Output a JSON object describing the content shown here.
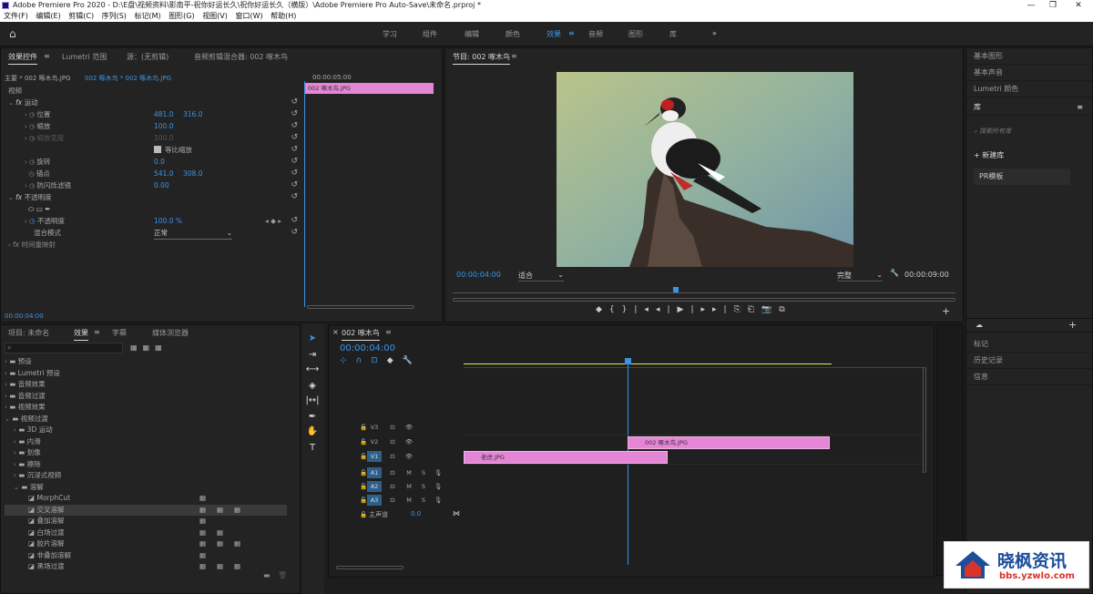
{
  "window": {
    "title": "Adobe Premiere Pro 2020 - D:\\E盘\\视频资料\\影南平-祝你好运长久\\祝你好运长久（横版）\\Adobe Premiere Pro Auto-Save\\未命名.prproj *",
    "min": "—",
    "max": "❐",
    "close": "✕"
  },
  "menu": [
    "文件(F)",
    "编辑(E)",
    "剪辑(C)",
    "序列(S)",
    "标记(M)",
    "图形(G)",
    "视图(V)",
    "窗口(W)",
    "帮助(H)"
  ],
  "workspaces": [
    "学习",
    "组件",
    "编辑",
    "颜色",
    "效果",
    "音频",
    "图形",
    "库"
  ],
  "workspace_more": "»",
  "effect_controls": {
    "tabs": [
      "效果控件",
      "Lumetri 范围",
      "源：(无剪辑)",
      "音频剪辑混合器: 002 啄木鸟"
    ],
    "master": "主要 * 002 啄木鸟.JPG",
    "clip": "002 啄木鸟 * 002 啄木鸟.JPG",
    "time_top": "00:00:05:00",
    "clip_label": "002 啄木鸟.JPG",
    "video": "视频",
    "motion": "运动",
    "position": "位置",
    "pos_x": "481.0",
    "pos_y": "316.0",
    "scale": "缩放",
    "scale_v": "100.0",
    "scale_w": "缩放宽度",
    "scale_w_v": "100.0",
    "uniform": "等比缩放",
    "rotation": "旋转",
    "rotation_v": "0.0",
    "anchor": "锚点",
    "anchor_x": "541.0",
    "anchor_y": "308.0",
    "flicker": "防闪烁滤镜",
    "flicker_v": "0.00",
    "opacity_group": "不透明度",
    "opacity": "不透明度",
    "opacity_v": "100.0 %",
    "blend": "混合模式",
    "blend_v": "正常",
    "remap": "时间重映射",
    "time": "00:00:04:00"
  },
  "program": {
    "title": "节目: 002 啄木鸟",
    "timecode": "00:00:04:00",
    "fit": "适合",
    "quality": "完整",
    "duration": "00:00:09:00"
  },
  "project": {
    "tabs": [
      "项目: 未命名",
      "效果",
      "字幕",
      "媒体浏览器"
    ],
    "items": [
      "预设",
      "Lumetri 预设",
      "音频效果",
      "音频过渡",
      "视频效果",
      "视频过渡",
      "3D 运动",
      "内滑",
      "划像",
      "擦除",
      "沉浸式视频",
      "溶解",
      "MorphCut",
      "交叉溶解",
      "叠加溶解",
      "白场过渡",
      "胶片溶解",
      "非叠加溶解",
      "黑场过渡"
    ]
  },
  "timeline": {
    "title": "002 啄木鸟",
    "timecode": "00:00:04:00",
    "tracks_v": [
      "V3",
      "V2",
      "V1"
    ],
    "tracks_a": [
      "A1",
      "A2",
      "A3"
    ],
    "master": "主声道",
    "master_val": "0.0",
    "clips": [
      {
        "name": "002 啄木鸟.JPG",
        "track": "V2"
      },
      {
        "name": "老虎.JPG",
        "track": "V1"
      }
    ],
    "mute": "M",
    "solo": "S"
  },
  "right_panel": {
    "items_top": [
      "基本图形",
      "基本声音",
      "Lumetri 颜色"
    ],
    "library": "库",
    "search": "搜索所有库",
    "new_lib": "+ 新建库",
    "lib_item": "PR模板",
    "items_bottom": [
      "标记",
      "历史记录",
      "信息"
    ]
  },
  "watermark": {
    "title": "晓枫资讯",
    "url": "bbs.yzwlo.com"
  }
}
